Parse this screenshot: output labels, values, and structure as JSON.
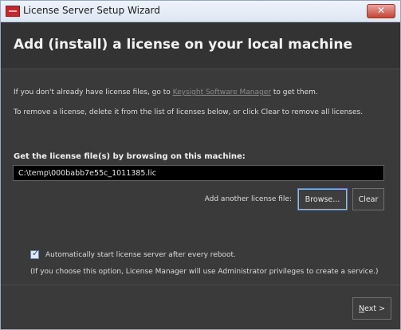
{
  "window": {
    "title": "License Server Setup Wizard",
    "close_glyph": "✕",
    "app_icon": "keysight-app-icon"
  },
  "header": {
    "title": "Add (install) a license on your local machine"
  },
  "info": {
    "line1_prefix": "If you don't already have license files, go to ",
    "line1_link": "Keysight Software Manager",
    "line1_suffix": " to get them.",
    "line2": "To remove a license, delete it from the list of licenses below, or click Clear to remove all licenses."
  },
  "browse_section": {
    "label": "Get the license file(s) by browsing on this machine:",
    "file_value": "C:\\temp\\000babb7e55c_1011385.lic",
    "another_label": "Add another license file:",
    "browse_label": "Browse...",
    "clear_label": "Clear"
  },
  "autostart": {
    "checked": true,
    "label": "Automatically start license server after every reboot.",
    "note": "(If you choose this option, License Manager will use Administrator privileges to create a service.)"
  },
  "footer": {
    "next_mnemonic": "N",
    "next_rest": "ext >"
  },
  "colors": {
    "background": "#3a3a3a",
    "header": "#333333",
    "input_bg": "#000000",
    "link": "#8a8a8a",
    "close_button": "#c7433a",
    "brand": "#c3282d"
  }
}
